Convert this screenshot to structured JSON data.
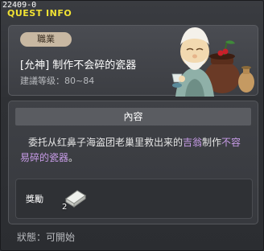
{
  "quest_id": "22409-0",
  "title": "QUEST INFO",
  "header": {
    "badge": "職業",
    "quest_name": "[允神]  制作不会碎的瓷器",
    "level": "建議等级：80~84"
  },
  "content": {
    "section_title": "內容",
    "description_parts": {
      "part1": "委托从红鼻子海盗团老巢里救出来的",
      "npc_name": "吉翁",
      "part2": "制作",
      "item_name": "不容易碎的瓷器",
      "part3": "。"
    },
    "reward_label": "獎勵",
    "reward_count": "2"
  },
  "status": "狀態：可開始",
  "colors": {
    "title": "#f1e233",
    "highlight": "#c89ce8"
  },
  "icons": {
    "npc": "old-potter-npc",
    "reward_item": "porcelain-item-icon"
  }
}
